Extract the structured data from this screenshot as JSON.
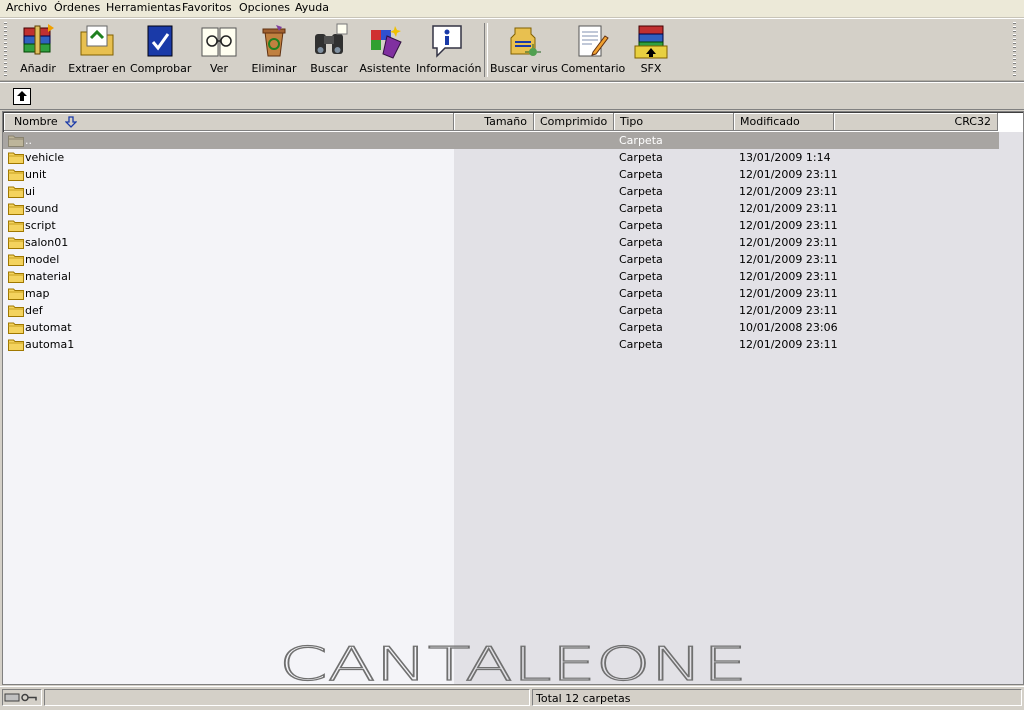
{
  "menu": [
    "Archivo",
    "Órdenes",
    "Herramientas",
    "Favoritos",
    "Opciones",
    "Ayuda"
  ],
  "toolbar": {
    "buttons": [
      {
        "label": "Añadir",
        "icon": "add-archive-icon"
      },
      {
        "label": "Extraer en",
        "icon": "extract-folder-icon"
      },
      {
        "label": "Comprobar",
        "icon": "test-archive-icon"
      },
      {
        "label": "Ver",
        "icon": "view-glasses-icon"
      },
      {
        "label": "Eliminar",
        "icon": "delete-recycle-icon"
      },
      {
        "label": "Buscar",
        "icon": "binoculars-icon"
      },
      {
        "label": "Asistente",
        "icon": "wizard-icon"
      },
      {
        "label": "Información",
        "icon": "info-icon"
      },
      {
        "label": "Buscar virus",
        "icon": "virus-scan-icon"
      },
      {
        "label": "Comentario",
        "icon": "comment-notepad-icon"
      },
      {
        "label": "SFX",
        "icon": "sfx-archive-icon"
      }
    ]
  },
  "columns": {
    "name": "Nombre",
    "size": "Tamaño",
    "packed": "Comprimido",
    "type": "Tipo",
    "modified": "Modificado",
    "crc": "CRC32"
  },
  "rows": [
    {
      "name": "..",
      "type": "Carpeta",
      "modified": ""
    },
    {
      "name": "vehicle",
      "type": "Carpeta",
      "modified": "13/01/2009 1:14"
    },
    {
      "name": "unit",
      "type": "Carpeta",
      "modified": "12/01/2009 23:11"
    },
    {
      "name": "ui",
      "type": "Carpeta",
      "modified": "12/01/2009 23:11"
    },
    {
      "name": "sound",
      "type": "Carpeta",
      "modified": "12/01/2009 23:11"
    },
    {
      "name": "script",
      "type": "Carpeta",
      "modified": "12/01/2009 23:11"
    },
    {
      "name": "salon01",
      "type": "Carpeta",
      "modified": "12/01/2009 23:11"
    },
    {
      "name": "model",
      "type": "Carpeta",
      "modified": "12/01/2009 23:11"
    },
    {
      "name": "material",
      "type": "Carpeta",
      "modified": "12/01/2009 23:11"
    },
    {
      "name": "map",
      "type": "Carpeta",
      "modified": "12/01/2009 23:11"
    },
    {
      "name": "def",
      "type": "Carpeta",
      "modified": "12/01/2009 23:11"
    },
    {
      "name": "automat",
      "type": "Carpeta",
      "modified": "10/01/2008 23:06"
    },
    {
      "name": "automa1",
      "type": "Carpeta",
      "modified": "12/01/2009 23:11"
    }
  ],
  "watermark": "CANTALEONE",
  "status": {
    "total": "Total 12 carpetas"
  },
  "colors": {
    "selected_row": "#a8a5a2",
    "folder": "#f4d35e",
    "background": "#d4d0c8"
  }
}
